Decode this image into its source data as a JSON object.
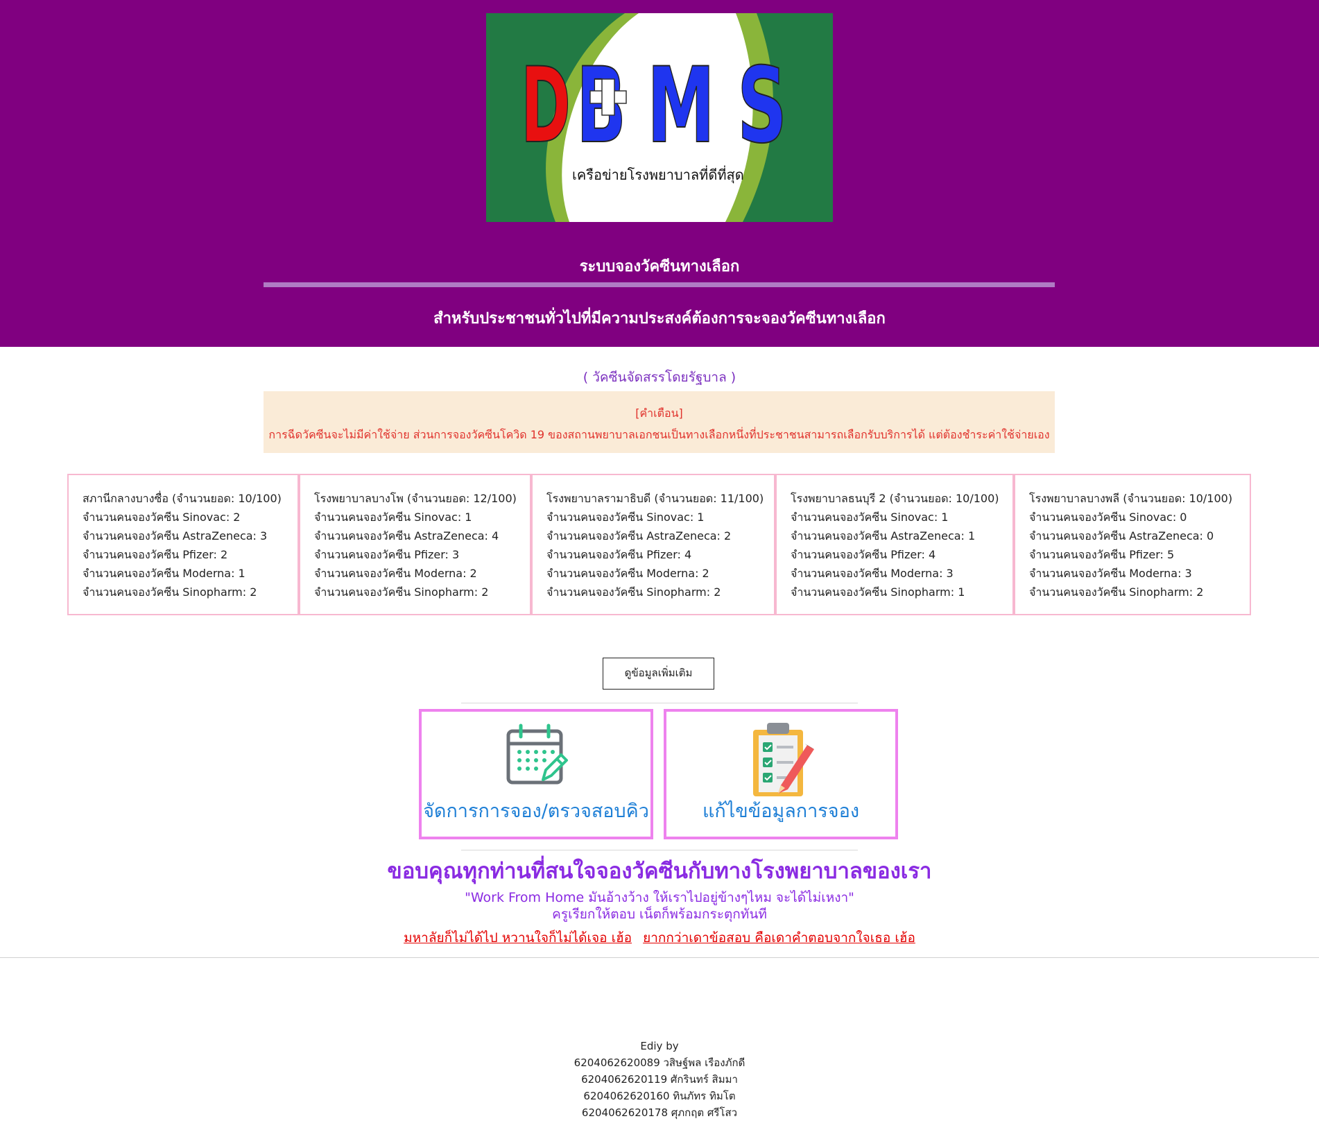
{
  "logo": {
    "letters": [
      "D",
      "B",
      "M",
      "S"
    ],
    "tagline": "เครือข่ายโรงพยาบาลที่ดีที่สุด",
    "colors": {
      "background": "#227a44",
      "swoosh_green": "#8ab53a",
      "letter_red": "#e81010",
      "letter_blue": "#1f35ef",
      "cross": "#ffffff"
    }
  },
  "header": {
    "title": "ระบบจองวัคซีนทางเลือก",
    "subtitle": "สำหรับประชาชนทั่วไปที่มีความประสงค์ต้องการจะจองวัคซีนทางเลือก",
    "background_color": "#800080"
  },
  "gov_note": "( วัคซีนจัดสรรโดยรัฐบาล )",
  "warning": {
    "title": "[คำเตือน]",
    "text": "การฉีดวัคซีนจะไม่มีค่าใช้จ่าย ส่วนการจองวัคซีนโควิด 19 ของสถานพยาบาลเอกชนเป็นทางเลือกหนึ่งที่ประชาชนสามารถเลือกรับบริการได้ แต่ต้องชำระค่าใช้จ่ายเอง"
  },
  "hospitals": [
    {
      "header": "สภานีกลางบางซื่อ (จำนวนยอด: 10/100)",
      "lines": [
        "จำนวนคนจองวัคซีน Sinovac: 2",
        "จำนวนคนจองวัคซีน AstraZeneca: 3",
        "จำนวนคนจองวัคซีน Pfizer: 2",
        "จำนวนคนจองวัคซีน Moderna: 1",
        "จำนวนคนจองวัคซีน Sinopharm: 2"
      ]
    },
    {
      "header": "โรงพยาบาลบางโพ (จำนวนยอด: 12/100)",
      "lines": [
        "จำนวนคนจองวัคซีน Sinovac: 1",
        "จำนวนคนจองวัคซีน AstraZeneca: 4",
        "จำนวนคนจองวัคซีน Pfizer: 3",
        "จำนวนคนจองวัคซีน Moderna: 2",
        "จำนวนคนจองวัคซีน Sinopharm: 2"
      ]
    },
    {
      "header": "โรงพยาบาลรามาธิบดี (จำนวนยอด: 11/100)",
      "lines": [
        "จำนวนคนจองวัคซีน Sinovac: 1",
        "จำนวนคนจองวัคซีน AstraZeneca: 2",
        "จำนวนคนจองวัคซีน Pfizer: 4",
        "จำนวนคนจองวัคซีน Moderna: 2",
        "จำนวนคนจองวัคซีน Sinopharm: 2"
      ]
    },
    {
      "header": "โรงพยาบาลธนบุรี 2 (จำนวนยอด: 10/100)",
      "lines": [
        "จำนวนคนจองวัคซีน Sinovac: 1",
        "จำนวนคนจองวัคซีน AstraZeneca: 1",
        "จำนวนคนจองวัคซีน Pfizer: 4",
        "จำนวนคนจองวัคซีน Moderna: 3",
        "จำนวนคนจองวัคซีน Sinopharm: 1"
      ]
    },
    {
      "header": "โรงพยาบาลบางพลี (จำนวนยอด: 10/100)",
      "lines": [
        "จำนวนคนจองวัคซีน Sinovac: 0",
        "จำนวนคนจองวัคซีน AstraZeneca: 0",
        "จำนวนคนจองวัคซีน Pfizer: 5",
        "จำนวนคนจองวัคซีน Moderna: 3",
        "จำนวนคนจองวัคซีน Sinopharm: 2"
      ]
    }
  ],
  "more_info_button": "ดูข้อมูลเพิ่มเติม",
  "actions": [
    {
      "label": "จัดการการจอง/ตรวจสอบคิว",
      "icon": "calendar-edit-icon"
    },
    {
      "label": "แก้ไขข้อมูลการจอง",
      "icon": "clipboard-checklist-pencil-icon"
    }
  ],
  "thanks": {
    "heading": "ขอบคุณทุกท่านที่สนใจจองวัคซีนกับทางโรงพยาบาลของเรา",
    "quote_line1": "\"Work From Home มันอ้างว้าง ให้เราไปอยู่ข้างๆไหม จะได้ไม่เหงา\"",
    "quote_line2": "ครูเรียกให้ตอบ เน็ตก็พร้อมกระตุกทันที",
    "link1": "มหาลัยก็ไม่ได้ไป หวานใจก็ไม่ได้เจอ เฮ้อ",
    "link2": "ยากกว่าเดาข้อสอบ คือเดาคำตอบจากใจเธอ เฮ้อ"
  },
  "credits": {
    "title": "Ediy by",
    "members": [
      "6204062620089 วสิษฐ์พล เรืองภักดี",
      "6204062620119 ศักรินทร์ สิมมา",
      "6204062620160 ทินภัทร ทิมโต",
      "6204062620178 ศุภกฤต ศรีโสว"
    ]
  }
}
